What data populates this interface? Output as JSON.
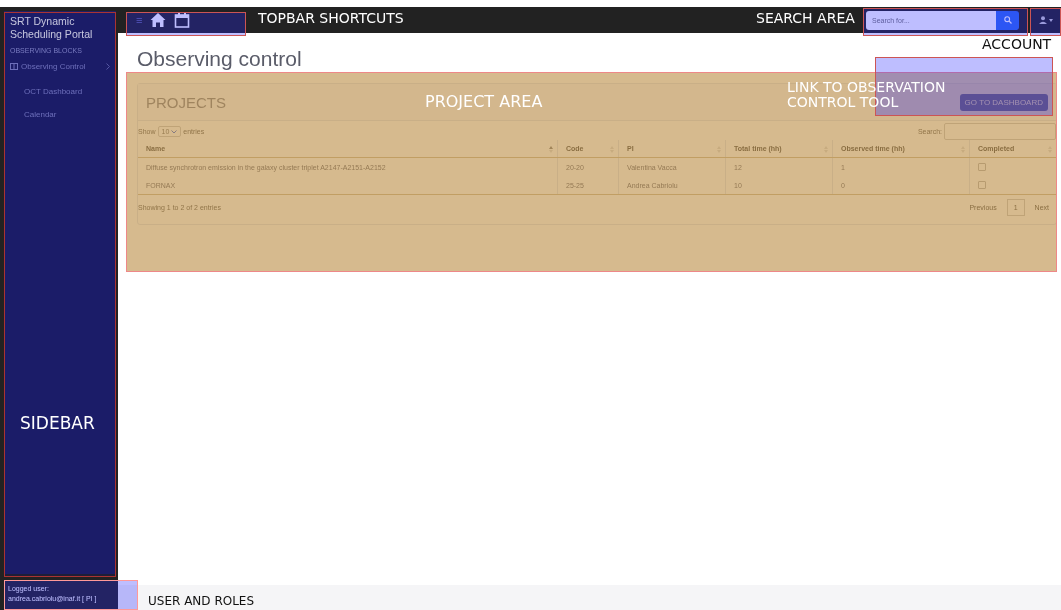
{
  "sidebar": {
    "brand": "SRT Dynamic Scheduling Portal",
    "section": "OBSERVING BLOCKS",
    "items": [
      {
        "label": "Observing Control",
        "expanded": true,
        "children": [
          {
            "label": "OCT Dashboard"
          },
          {
            "label": "Calendar"
          }
        ]
      }
    ],
    "footer": {
      "caption": "Logged user:",
      "user": "andrea.cabriolu@inaf.it [ PI ]"
    }
  },
  "topbar": {
    "menu_glyph": "≡",
    "search": {
      "placeholder": "Search for..."
    }
  },
  "page": {
    "title": "Observing control",
    "card": {
      "title": "PROJECTS",
      "button": "GO TO DASHBOARD",
      "length": {
        "before": "Show",
        "value": "10",
        "after": "entries"
      },
      "search_label": "Search:",
      "columns": [
        {
          "label": "Name",
          "sorted": true
        },
        {
          "label": "Code",
          "sorted": false
        },
        {
          "label": "PI",
          "sorted": false
        },
        {
          "label": "Total time (hh)",
          "sorted": false
        },
        {
          "label": "Observed time (hh)",
          "sorted": false
        },
        {
          "label": "Completed",
          "sorted": false
        }
      ],
      "rows": [
        {
          "name": "Diffuse synchrotron emission in the galaxy cluster triplet A2147-A2151-A2152",
          "code": "20-20",
          "pi": "Valentina Vacca",
          "total": "12",
          "observed": "1",
          "completed": false
        },
        {
          "name": "FORNAX",
          "code": "25-25",
          "pi": "Andrea Cabriolu",
          "total": "10",
          "observed": "0",
          "completed": false
        }
      ],
      "info": "Showing 1 to 2 of 2 entries",
      "pagination": [
        {
          "label": "Previous",
          "selected": false
        },
        {
          "label": "1",
          "selected": true
        },
        {
          "label": "Next",
          "selected": false
        }
      ]
    }
  },
  "annotations": [
    {
      "kind": "sidebar",
      "label": "SIDEBAR"
    },
    {
      "kind": "shortcuts",
      "label": "TOPBAR SHORTCUTS"
    },
    {
      "kind": "search",
      "label": "SEARCH AREA"
    },
    {
      "kind": "account",
      "label": "ACCOUNT"
    },
    {
      "kind": "project",
      "label": "PROJECT AREA"
    },
    {
      "kind": "link",
      "label": "LINK TO OBSERVATION CONTROL TOOL"
    },
    {
      "kind": "user",
      "label": "USER AND ROLES"
    }
  ]
}
